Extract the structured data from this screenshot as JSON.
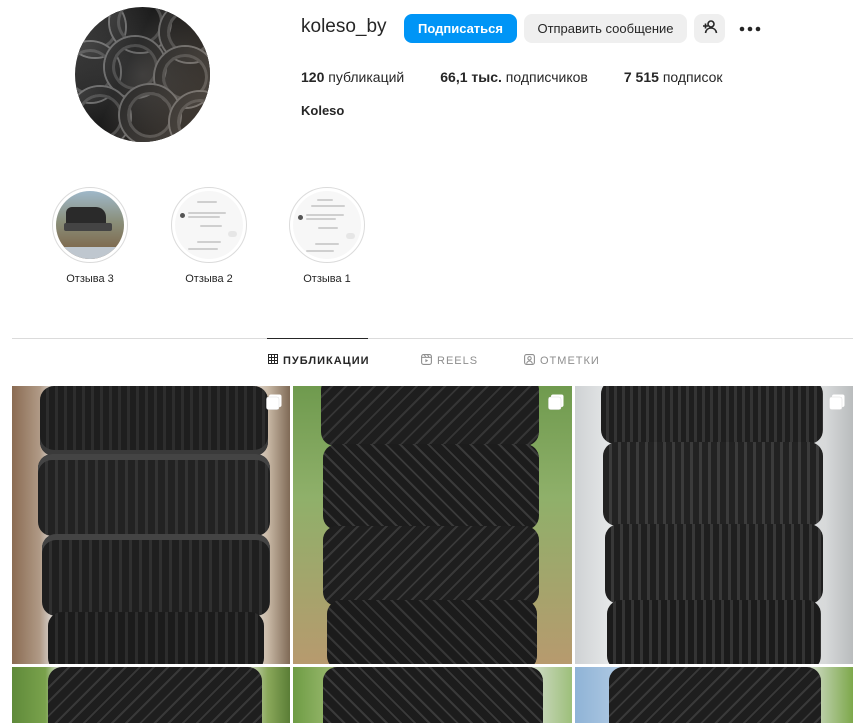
{
  "profile": {
    "username": "koleso_by",
    "follow_label": "Подписаться",
    "message_label": "Отправить сообщение",
    "fullname": "Koleso"
  },
  "stats": {
    "posts_count": "120",
    "posts_label": "публикаций",
    "followers_count": "66,1 тыс.",
    "followers_label": "подписчиков",
    "following_count": "7 515",
    "following_label": "подписок"
  },
  "highlights": [
    {
      "label": "Отзыва 3"
    },
    {
      "label": "Отзыва 2"
    },
    {
      "label": "Отзыва 1"
    }
  ],
  "tabs": [
    {
      "label": "ПУБЛИКАЦИИ",
      "icon": "grid-icon",
      "active": true
    },
    {
      "label": "REELS",
      "icon": "reels-icon",
      "active": false
    },
    {
      "label": "ОТМЕТКИ",
      "icon": "tagged-icon",
      "active": false
    }
  ],
  "posts": [
    {
      "type": "summer-tires-stack",
      "multi": true
    },
    {
      "type": "winter-tires-stack",
      "multi": true
    },
    {
      "type": "allseason-tires-stack",
      "multi": true
    },
    {
      "type": "winter-tires-stack",
      "multi": false
    },
    {
      "type": "winter-tires-stack",
      "multi": false
    },
    {
      "type": "winter-tires-stack",
      "multi": false
    }
  ],
  "colors": {
    "accent": "#0095f6",
    "secondary_button": "#efefef",
    "text": "#262626",
    "muted": "#8e8e8e",
    "border": "#dbdbdb"
  }
}
